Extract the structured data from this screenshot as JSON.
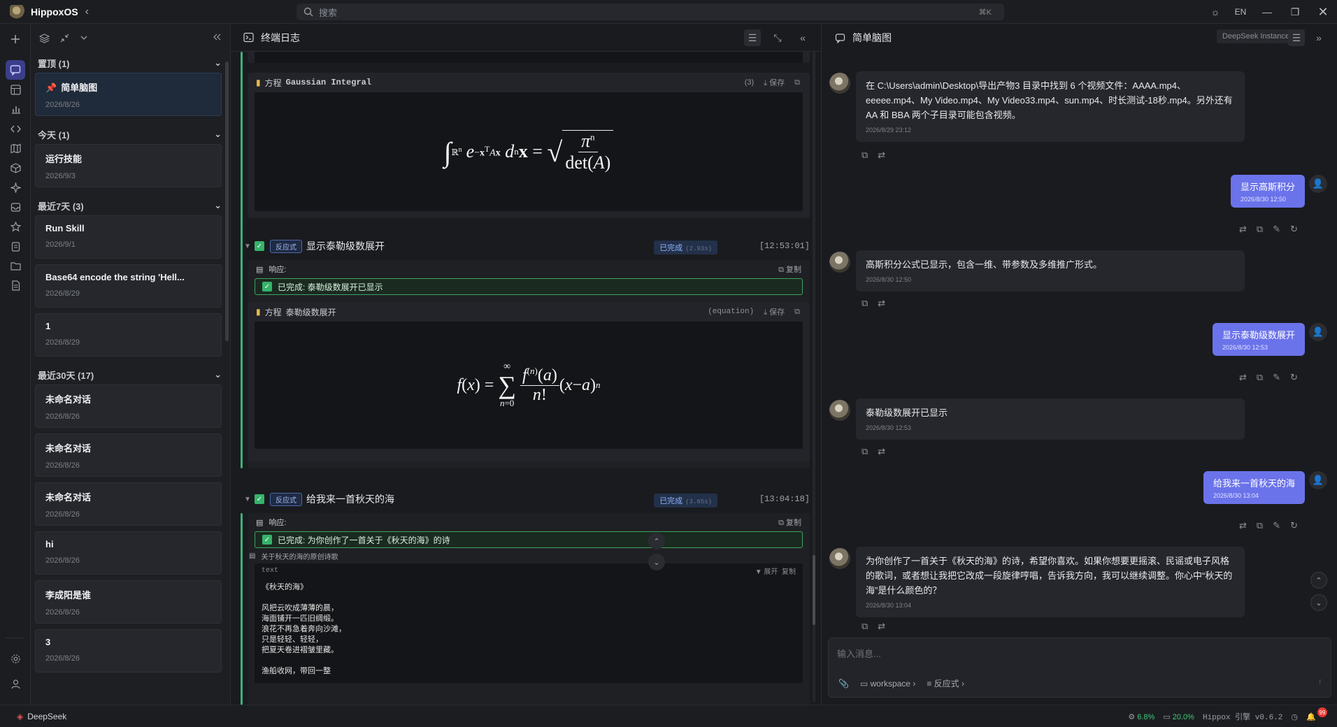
{
  "app": {
    "name": "HippoxOS"
  },
  "search": {
    "placeholder": "搜索",
    "shortcut": "⌘K"
  },
  "topbar": {
    "lang": "EN"
  },
  "sidebar": {
    "groups": [
      {
        "title": "置顶 (1)",
        "items": [
          {
            "title": "简单脑图",
            "date": "2026/8/26",
            "pinned": true
          }
        ]
      },
      {
        "title": "今天 (1)",
        "items": [
          {
            "title": "运行技能",
            "date": "2026/9/3"
          }
        ]
      },
      {
        "title": "最近7天 (3)",
        "items": [
          {
            "title": "Run Skill",
            "date": "2026/9/1"
          },
          {
            "title": "Base64 encode the string 'Hell...",
            "date": "2026/8/29"
          },
          {
            "title": "1",
            "date": "2026/8/29"
          }
        ]
      },
      {
        "title": "最近30天 (17)",
        "items": [
          {
            "title": "未命名对话",
            "date": "2026/8/26"
          },
          {
            "title": "未命名对话",
            "date": "2026/8/26"
          },
          {
            "title": "未命名对话",
            "date": "2026/8/26"
          },
          {
            "title": "hi",
            "date": "2026/8/26"
          },
          {
            "title": "李成阳是谁",
            "date": "2026/8/26"
          },
          {
            "title": "3",
            "date": "2026/8/26"
          }
        ]
      }
    ]
  },
  "terminal": {
    "title": "终端日志",
    "card1": {
      "label": "方程",
      "name": "Gaussian Integral",
      "count": "(3)",
      "save": "保存"
    },
    "task2": {
      "tag": "反应式",
      "title": "显示泰勒级数展开",
      "status": "已完成",
      "duration": "(2.93s)",
      "time": "[12:53:01]",
      "response_label": "响应:",
      "copy": "复制",
      "done_text": "已完成: 泰勒级数展开已显示",
      "card_label": "方程",
      "card_name": "泰勒级数展开",
      "card_kind": "(equation)",
      "save": "保存"
    },
    "task3": {
      "tag": "反应式",
      "title": "给我来一首秋天的海",
      "status": "已完成",
      "duration": "(3.65s)",
      "time": "[13:04:18]",
      "response_label": "响应:",
      "copy": "复制",
      "done_text": "已完成: 为你创作了一首关于《秋天的海》的诗",
      "file_label": "关于秋天的海的原创诗歌",
      "lang": "text",
      "expand": "▼ 展开",
      "copy2": "复制",
      "poem": "《秋天的海》\n\n风把云吹成薄薄的晨，\n海面铺开一匹旧绸缎。\n浪花不再急着奔向沙滩，\n只是轻轻、轻轻，\n把夏天卷进褶皱里藏。\n\n渔船收网，带回一整"
    }
  },
  "chat": {
    "title": "简单脑图",
    "instance": "DeepSeek Instance",
    "messages": [
      {
        "role": "assistant",
        "text": "在 C:\\Users\\admin\\Desktop\\导出产物3 目录中找到 6 个视频文件：AAAA.mp4、eeeee.mp4、My Video.mp4、My Video33.mp4、sun.mp4、时长测试-18秒.mp4。另外还有 AA 和 BBA 两个子目录可能包含视频。",
        "time": "2026/8/29 23:12"
      },
      {
        "role": "user",
        "text": "显示高斯积分",
        "time": "2026/8/30 12:50"
      },
      {
        "role": "assistant",
        "text": "高斯积分公式已显示，包含一维、带参数及多维推广形式。",
        "time": "2026/8/30 12:50"
      },
      {
        "role": "user",
        "text": "显示泰勒级数展开",
        "time": "2026/8/30 12:53"
      },
      {
        "role": "assistant",
        "text": "泰勒级数展开已显示",
        "time": "2026/8/30 12:53"
      },
      {
        "role": "user",
        "text": "给我来一首秋天的海",
        "time": "2026/8/30 13:04"
      },
      {
        "role": "assistant",
        "text": "为你创作了一首关于《秋天的海》的诗，希望你喜欢。如果你想要更摇滚、民谣或电子风格的歌词，或者想让我把它改成一段旋律哼唱，告诉我方向，我可以继续调整。你心中“秋天的海”是什么颜色的？",
        "time": "2026/8/30 13:04"
      }
    ],
    "input_placeholder": "输入消息...",
    "workspace": "workspace",
    "mode": "反应式"
  },
  "statusbar": {
    "brand": "DeepSeek",
    "cpu": "6.8%",
    "mem": "20.0%",
    "version": "Hippox 引擎 v0.6.2",
    "notifications": "99"
  },
  "colors": {
    "accent": "#6b73ea",
    "success": "#35b36b",
    "background": "#1a1b1f"
  }
}
